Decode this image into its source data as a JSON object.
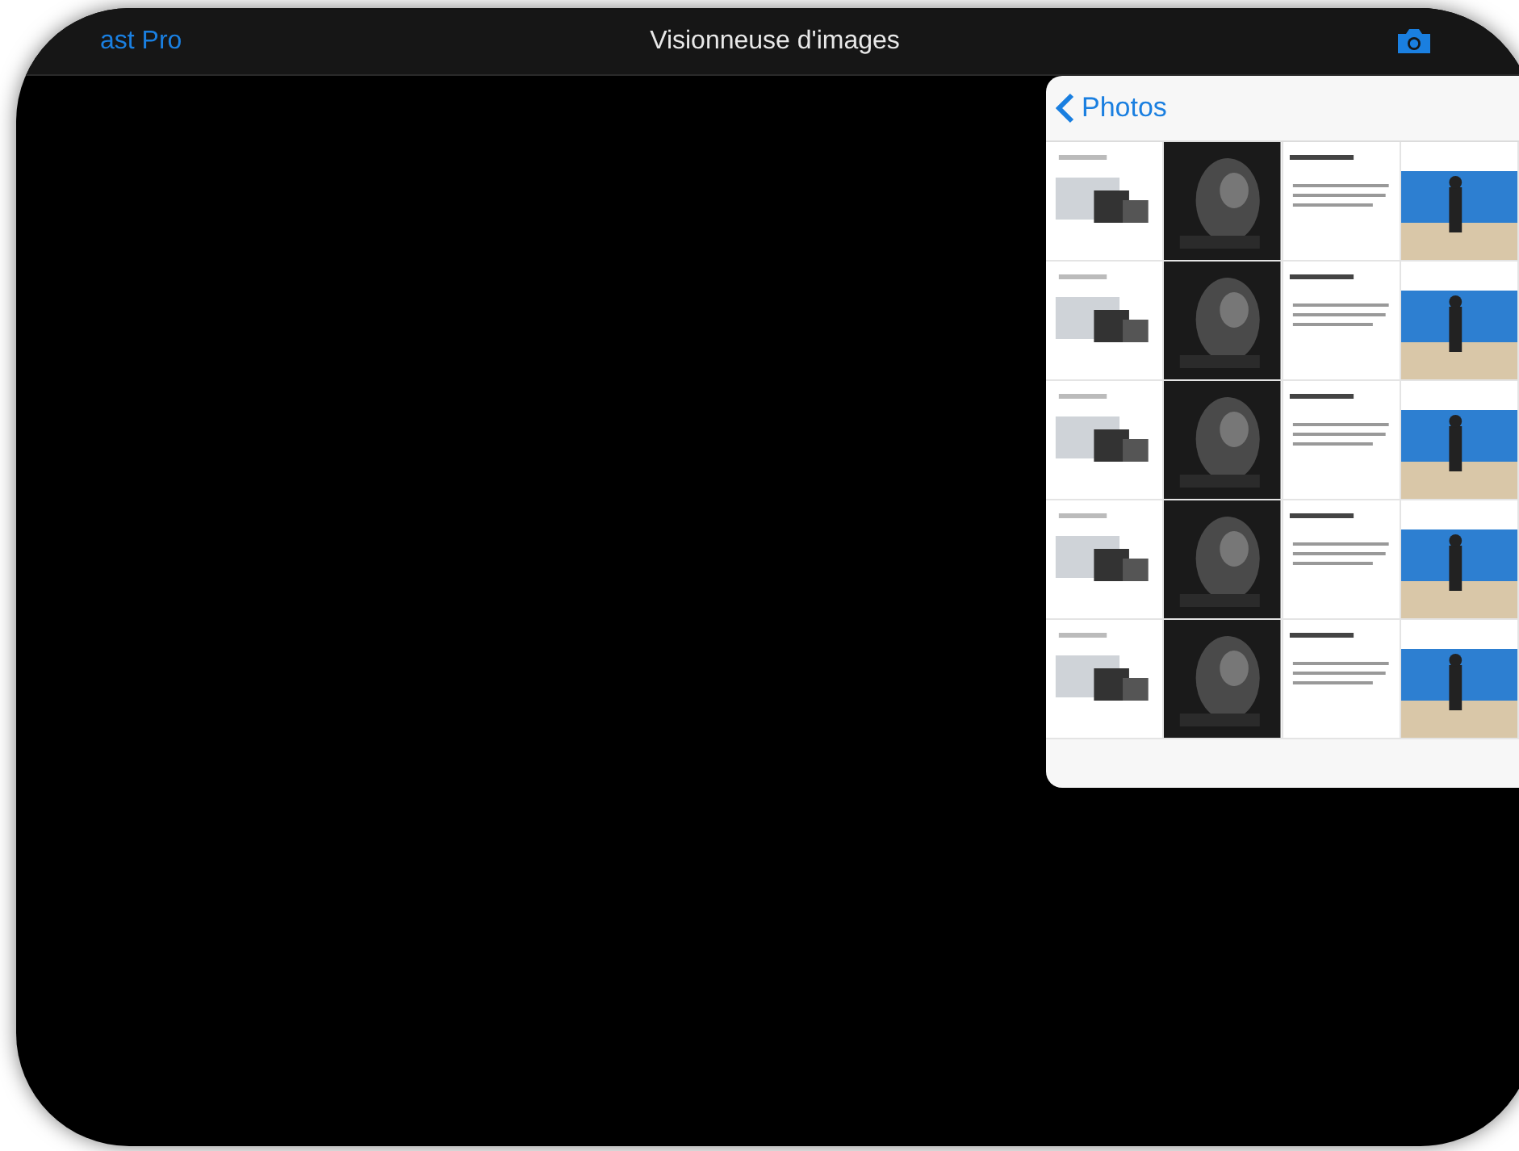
{
  "nav_bar": {
    "back_label": "ast Pro",
    "title": "Visionneuse d'images"
  },
  "popover": {
    "back_label": "Photos"
  }
}
